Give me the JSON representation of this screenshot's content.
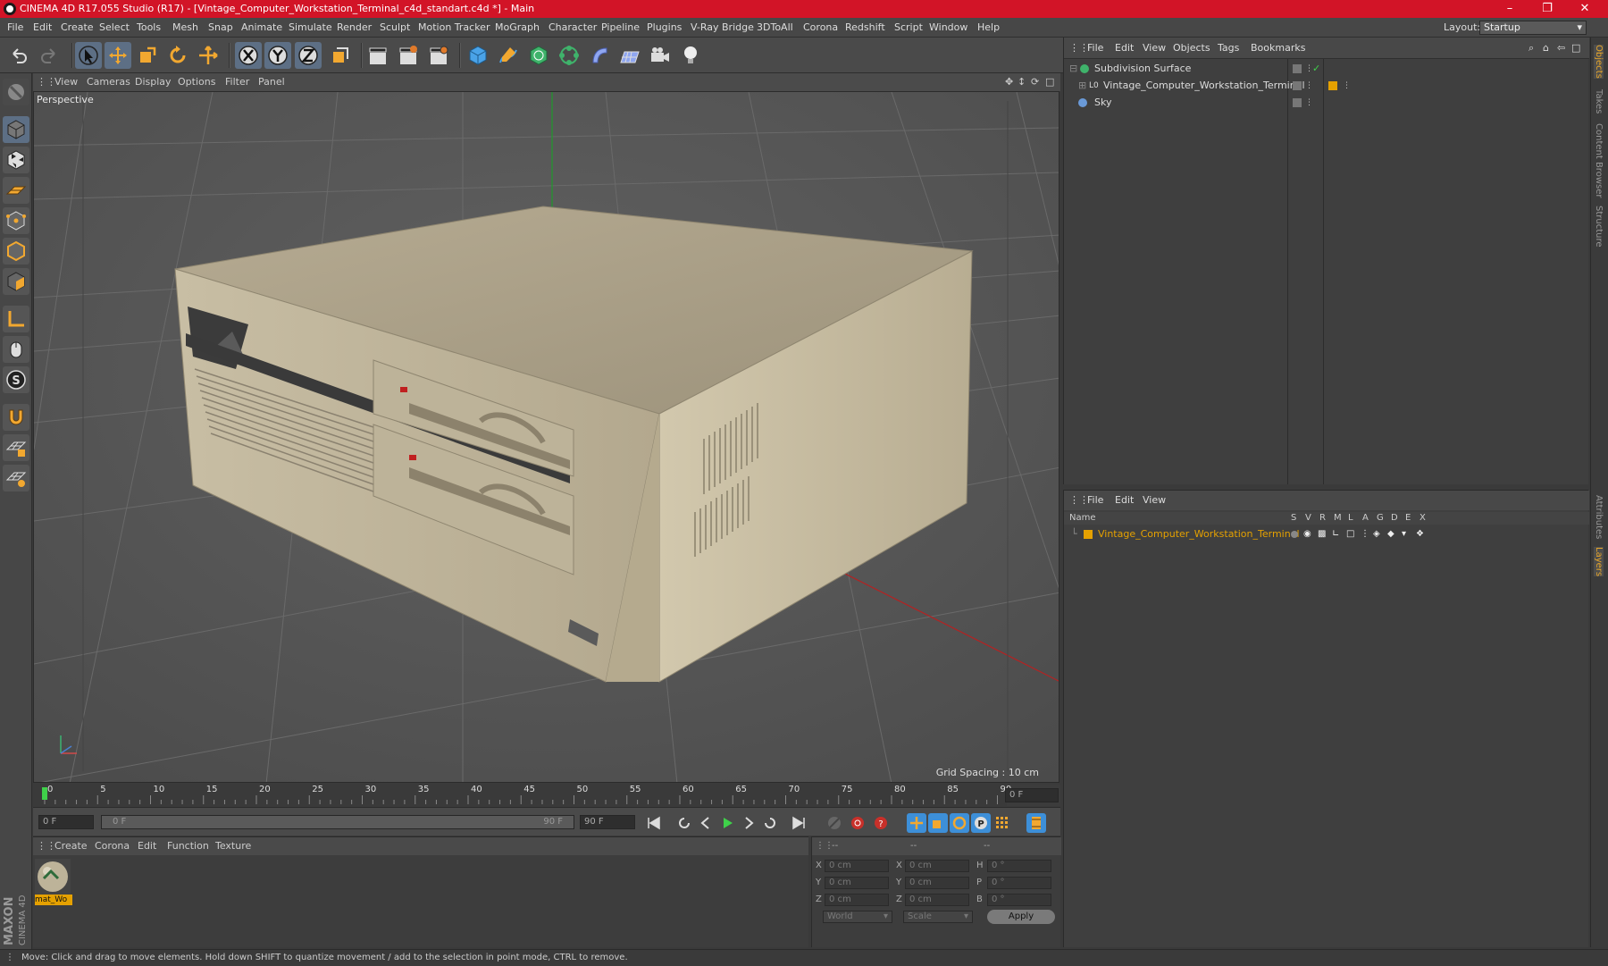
{
  "window": {
    "title": "CINEMA 4D R17.055 Studio (R17) - [Vintage_Computer_Workstation_Terminal_c4d_standart.c4d *] - Main"
  },
  "menubar": {
    "items": [
      "File",
      "Edit",
      "Create",
      "Select",
      "Tools",
      "Mesh",
      "Snap",
      "Animate",
      "Simulate",
      "Render",
      "Sculpt",
      "Motion Tracker",
      "MoGraph",
      "Character",
      "Pipeline",
      "Plugins",
      "V-Ray Bridge",
      "3DToAll",
      "Corona",
      "Redshift",
      "Script",
      "Window",
      "Help"
    ],
    "layout_label": "Layout:",
    "layout_value": "Startup"
  },
  "viewport": {
    "menu": [
      "View",
      "Cameras",
      "Display",
      "Options",
      "Filter",
      "Panel"
    ],
    "label": "Perspective",
    "grid_spacing": "Grid Spacing : 10 cm"
  },
  "timeline": {
    "ticks": [
      "0",
      "5",
      "10",
      "15",
      "20",
      "25",
      "30",
      "35",
      "40",
      "45",
      "50",
      "55",
      "60",
      "65",
      "70",
      "75",
      "80",
      "85",
      "90"
    ],
    "current_frame_field": "0 F"
  },
  "transport": {
    "start_field": "0 F",
    "range_start": "0 F",
    "range_end": "90 F",
    "end_field": "90 F"
  },
  "material_panel": {
    "menu": [
      "Create",
      "Corona",
      "Edit",
      "Function",
      "Texture"
    ],
    "materials": [
      {
        "name": "mat_Wo"
      }
    ]
  },
  "coord_panel": {
    "headers": [
      "--",
      "--",
      "--"
    ],
    "rows": [
      {
        "l1": "X",
        "v1": "0 cm",
        "l2": "X",
        "v2": "0 cm",
        "l3": "H",
        "v3": "0 °"
      },
      {
        "l1": "Y",
        "v1": "0 cm",
        "l2": "Y",
        "v2": "0 cm",
        "l3": "P",
        "v3": "0 °"
      },
      {
        "l1": "Z",
        "v1": "0 cm",
        "l2": "Z",
        "v2": "0 cm",
        "l3": "B",
        "v3": "0 °"
      }
    ],
    "mode_world": "World",
    "mode_scale": "Scale",
    "apply_label": "Apply"
  },
  "objects_panel": {
    "menu": [
      "File",
      "Edit",
      "View",
      "Objects",
      "Tags",
      "Bookmarks"
    ],
    "objects": [
      {
        "name": "Subdivision Surface"
      },
      {
        "name": "Vintage_Computer_Workstation_Terminal"
      },
      {
        "name": "Sky"
      }
    ]
  },
  "layers_panel": {
    "menu": [
      "File",
      "Edit",
      "View"
    ],
    "columns": [
      "Name",
      "S",
      "V",
      "R",
      "M",
      "L",
      "A",
      "G",
      "D",
      "E",
      "X"
    ],
    "layers": [
      {
        "name": "Vintage_Computer_Workstation_Terminal",
        "color": "#e5a100"
      }
    ]
  },
  "side_tabs": [
    "Objects",
    "Takes",
    "Content Browser",
    "Structure",
    "Attributes",
    "Layers"
  ],
  "statusbar": {
    "text": "Move: Click and drag to move elements. Hold down SHIFT to quantize movement / add to the selection in point mode, CTRL to remove."
  },
  "colors": {
    "titlebar": "#d21427",
    "accent_orange": "#e5a100",
    "active_blue": "#3d8fd8"
  }
}
